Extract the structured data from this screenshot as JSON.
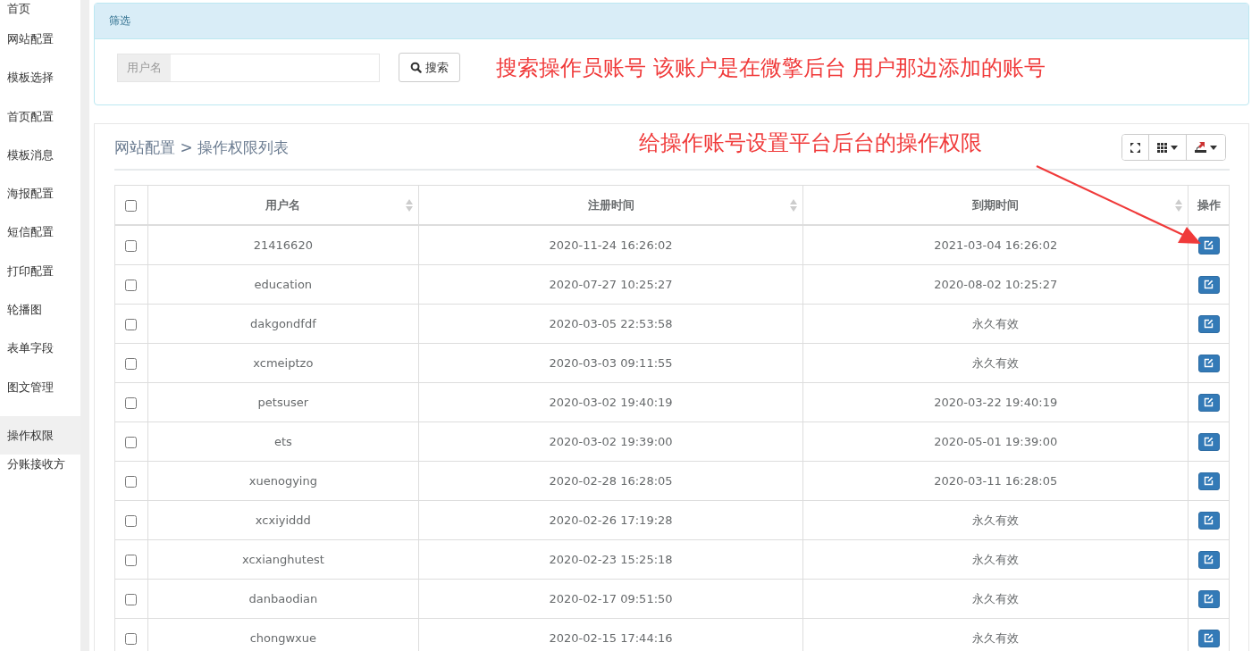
{
  "sidebar": {
    "items": [
      {
        "label": "首页",
        "selected": false
      },
      {
        "label": "网站配置",
        "selected": false
      },
      {
        "label": "模板选择",
        "selected": false
      },
      {
        "label": "首页配置",
        "selected": false
      },
      {
        "label": "模板消息",
        "selected": false
      },
      {
        "label": "海报配置",
        "selected": false
      },
      {
        "label": "短信配置",
        "selected": false
      },
      {
        "label": "打印配置",
        "selected": false
      },
      {
        "label": "轮播图",
        "selected": false
      },
      {
        "label": "表单字段",
        "selected": false
      },
      {
        "label": "图文管理",
        "selected": false
      },
      {
        "label": "操作权限",
        "selected": true
      },
      {
        "label": "分账接收方",
        "selected": false
      }
    ]
  },
  "filter": {
    "title": "筛选",
    "field_label": "用户名",
    "search_button": "搜索",
    "annotation": "搜索操作员账号 该账户是在微擎后台 用户那边添加的账号"
  },
  "list": {
    "breadcrumb": "网站配置 > 操作权限列表",
    "annotation": "给操作账号设置平台后台的操作权限",
    "table": {
      "select_all_checked": false,
      "columns": [
        "用户名",
        "注册时间",
        "到期时间",
        "操作"
      ],
      "rows": [
        {
          "checked": false,
          "cells": [
            "21416620",
            "2020-11-24 16:26:02",
            "2021-03-04 16:26:02"
          ]
        },
        {
          "checked": false,
          "cells": [
            "education",
            "2020-07-27 10:25:27",
            "2020-08-02 10:25:27"
          ]
        },
        {
          "checked": false,
          "cells": [
            "dakgondfdf",
            "2020-03-05 22:53:58",
            "永久有效"
          ]
        },
        {
          "checked": false,
          "cells": [
            "xcmeiptzo",
            "2020-03-03 09:11:55",
            "永久有效"
          ]
        },
        {
          "checked": false,
          "cells": [
            "petsuser",
            "2020-03-02 19:40:19",
            "2020-03-22 19:40:19"
          ]
        },
        {
          "checked": false,
          "cells": [
            "ets",
            "2020-03-02 19:39:00",
            "2020-05-01 19:39:00"
          ]
        },
        {
          "checked": false,
          "cells": [
            "xuenogying",
            "2020-02-28 16:28:05",
            "2020-03-11 16:28:05"
          ]
        },
        {
          "checked": false,
          "cells": [
            "xcxiyiddd",
            "2020-02-26 17:19:28",
            "永久有效"
          ]
        },
        {
          "checked": false,
          "cells": [
            "xcxianghutest",
            "2020-02-23 15:25:18",
            "永久有效"
          ]
        },
        {
          "checked": false,
          "cells": [
            "danbaodian",
            "2020-02-17 09:51:50",
            "永久有效"
          ]
        },
        {
          "checked": false,
          "cells": [
            "chongwxue",
            "2020-02-15 17:44:16",
            "永久有效"
          ]
        }
      ]
    }
  }
}
